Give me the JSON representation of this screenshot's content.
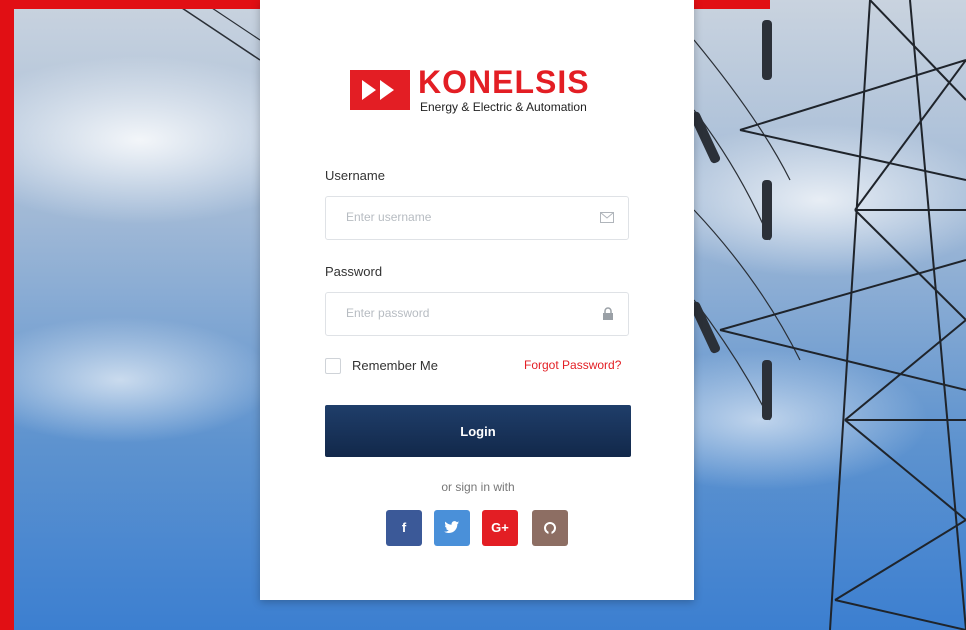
{
  "brand": {
    "name": "KONELSIS",
    "tagline": "Energy & Electric & Automation",
    "color": "#e31e24"
  },
  "form": {
    "username_label": "Username",
    "username_placeholder": "Enter username",
    "username_icon": "envelope-icon",
    "password_label": "Password",
    "password_placeholder": "Enter password",
    "password_icon": "lock-icon",
    "remember_label": "Remember Me",
    "forgot_label": "Forgot Password?",
    "login_label": "Login",
    "login_color": "#1b365d"
  },
  "social": {
    "caption": "or sign in with",
    "buttons": [
      {
        "label": "f",
        "icon": "facebook-icon",
        "color": "#3b5998"
      },
      {
        "label": "🐦",
        "icon": "twitter-icon",
        "color": "#4a90d9"
      },
      {
        "label": "G+",
        "icon": "google-plus-icon",
        "color": "#e31e24"
      },
      {
        "label": "◯",
        "icon": "github-icon",
        "color": "#8d6e63"
      }
    ]
  }
}
